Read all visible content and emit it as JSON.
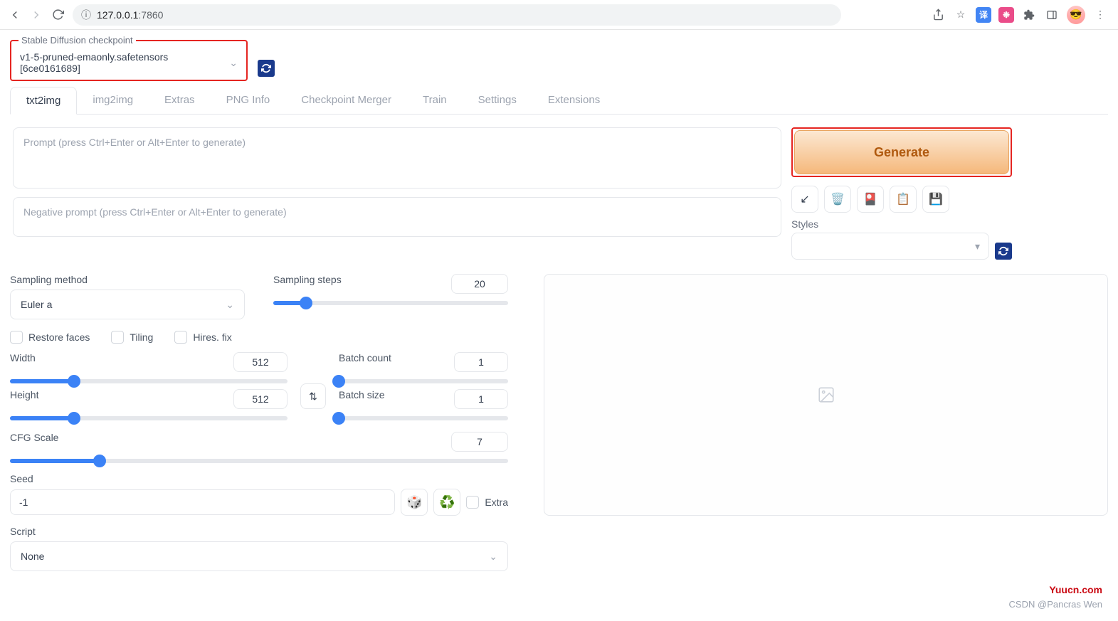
{
  "browser": {
    "url_host": "127.0.0.1",
    "url_port": ":7860",
    "info_icon": "ⓘ"
  },
  "checkpoint": {
    "label": "Stable Diffusion checkpoint",
    "value": "v1-5-pruned-emaonly.safetensors [6ce0161689]"
  },
  "tabs": [
    "txt2img",
    "img2img",
    "Extras",
    "PNG Info",
    "Checkpoint Merger",
    "Train",
    "Settings",
    "Extensions"
  ],
  "prompt": {
    "placeholder": "Prompt (press Ctrl+Enter or Alt+Enter to generate)",
    "neg_placeholder": "Negative prompt (press Ctrl+Enter or Alt+Enter to generate)"
  },
  "generate": {
    "label": "Generate"
  },
  "styles": {
    "label": "Styles"
  },
  "sampling": {
    "method_label": "Sampling method",
    "method_value": "Euler a",
    "steps_label": "Sampling steps",
    "steps_value": "20"
  },
  "checks": {
    "restore": "Restore faces",
    "tiling": "Tiling",
    "hires": "Hires. fix"
  },
  "dims": {
    "width_label": "Width",
    "width_value": "512",
    "height_label": "Height",
    "height_value": "512"
  },
  "batch": {
    "count_label": "Batch count",
    "count_value": "1",
    "size_label": "Batch size",
    "size_value": "1"
  },
  "cfg": {
    "label": "CFG Scale",
    "value": "7"
  },
  "seed": {
    "label": "Seed",
    "value": "-1",
    "extra_label": "Extra"
  },
  "script": {
    "label": "Script",
    "value": "None"
  },
  "watermark": {
    "site": "Yuucn.com",
    "csdn": "CSDN @Pancras Wen"
  }
}
